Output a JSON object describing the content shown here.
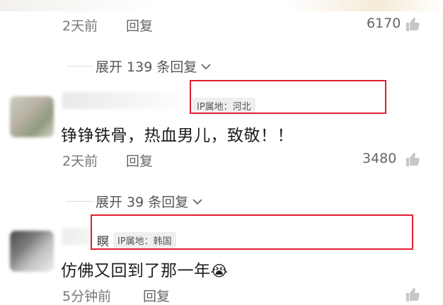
{
  "comments": [
    {
      "time": "2天前",
      "reply_label": "回复",
      "likes": "6170",
      "expand_label": "展开 139 条回复"
    },
    {
      "username_hint": "",
      "ip_label": "IP属地：河北",
      "text": "铮铮铁骨，热血男儿，致敬！！",
      "time": "2天前",
      "reply_label": "回复",
      "likes": "3480",
      "expand_label": "展开 39 条回复"
    },
    {
      "username_hint": "瞑",
      "ip_label": "IP属地：韩国",
      "text": "仿佛又回到了那一年",
      "emoji": "😭",
      "time": "5分钟前",
      "reply_label": "回复",
      "likes": ""
    }
  ],
  "icons": {
    "like": "thumbs-up-icon",
    "chevron": "chevron-down-icon",
    "emoji": "crying-face-emoji"
  },
  "colors": {
    "highlight": "#e11f2f",
    "text": "#1f1f1f",
    "meta": "#777777"
  }
}
